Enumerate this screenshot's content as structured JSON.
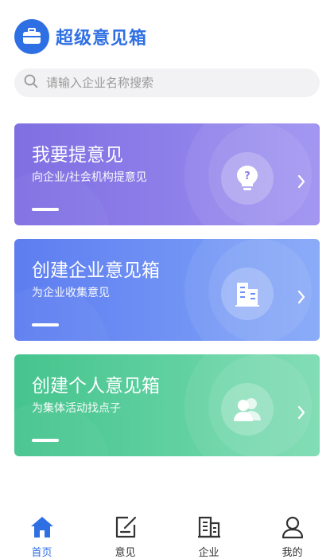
{
  "header": {
    "app_title": "超级意见箱"
  },
  "search": {
    "placeholder": "请输入企业名称搜索"
  },
  "cards": [
    {
      "title": "我要提意见",
      "subtitle": "向企业/社会机构提意见"
    },
    {
      "title": "创建企业意见箱",
      "subtitle": "为企业收集意见"
    },
    {
      "title": "创建个人意见箱",
      "subtitle": "为集体活动找点子"
    }
  ],
  "tabbar": {
    "items": [
      {
        "label": "首页",
        "icon": "home-icon",
        "active": true
      },
      {
        "label": "意见",
        "icon": "edit-icon",
        "active": false
      },
      {
        "label": "企业",
        "icon": "building-icon",
        "active": false
      },
      {
        "label": "我的",
        "icon": "user-icon",
        "active": false
      }
    ]
  },
  "colors": {
    "brand": "#2f6fe4",
    "card_purple": "#8a7cea",
    "card_blue": "#6b8ff3",
    "card_green": "#55cc9a"
  }
}
